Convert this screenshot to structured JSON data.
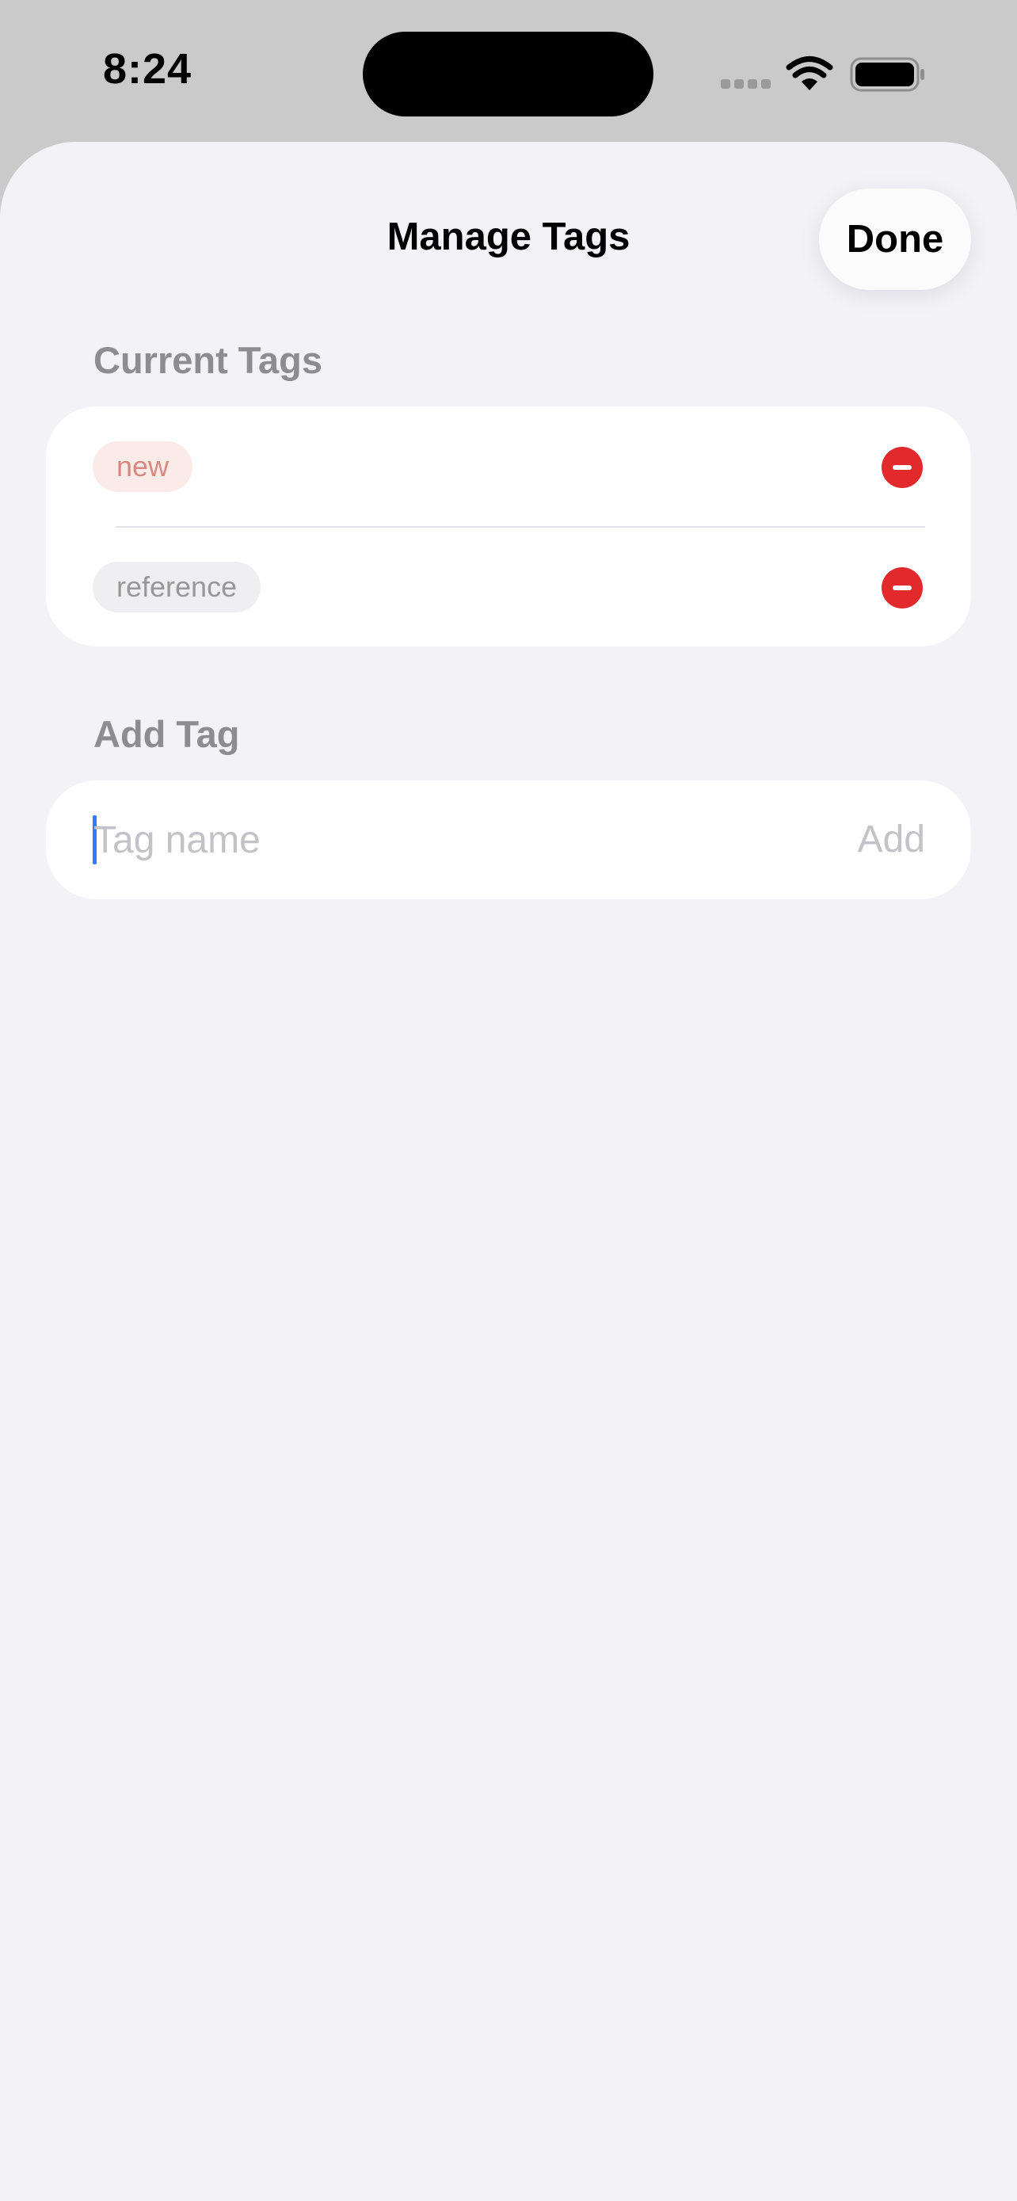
{
  "status_bar": {
    "time": "8:24"
  },
  "sheet": {
    "title": "Manage Tags",
    "done_label": "Done"
  },
  "current_tags": {
    "header": "Current Tags",
    "items": [
      {
        "label": "new",
        "color": "#d88a80",
        "background": "#fbebe8"
      },
      {
        "label": "reference",
        "color": "#97979c",
        "background": "#efeff1"
      }
    ]
  },
  "add_tag": {
    "header": "Add Tag",
    "placeholder": "Tag name",
    "value": "",
    "button_label": "Add"
  },
  "colors": {
    "accent": "#2f7cf6",
    "destructive": "#e22a2c",
    "sheet_background": "#f2f2f7"
  },
  "icons": {
    "wifi": "wifi-icon",
    "battery": "battery-full-icon",
    "remove": "minus-circle-icon"
  }
}
